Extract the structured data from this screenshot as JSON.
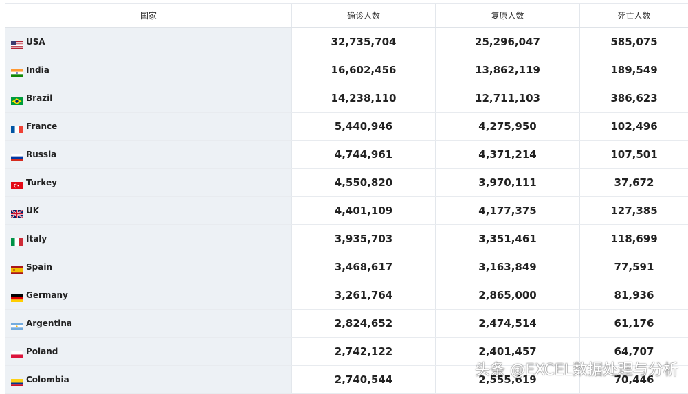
{
  "table": {
    "headers": [
      "国家",
      "确诊人数",
      "复原人数",
      "死亡人数"
    ],
    "rows": [
      {
        "country": "USA",
        "flag": "us-flag-icon",
        "confirmed": "32,735,704",
        "recovered": "25,296,047",
        "deaths": "585,075"
      },
      {
        "country": "India",
        "flag": "india-flag-icon",
        "confirmed": "16,602,456",
        "recovered": "13,862,119",
        "deaths": "189,549"
      },
      {
        "country": "Brazil",
        "flag": "brazil-flag-icon",
        "confirmed": "14,238,110",
        "recovered": "12,711,103",
        "deaths": "386,623"
      },
      {
        "country": "France",
        "flag": "france-flag-icon",
        "confirmed": "5,440,946",
        "recovered": "4,275,950",
        "deaths": "102,496"
      },
      {
        "country": "Russia",
        "flag": "russia-flag-icon",
        "confirmed": "4,744,961",
        "recovered": "4,371,214",
        "deaths": "107,501"
      },
      {
        "country": "Turkey",
        "flag": "turkey-flag-icon",
        "confirmed": "4,550,820",
        "recovered": "3,970,111",
        "deaths": "37,672"
      },
      {
        "country": "UK",
        "flag": "uk-flag-icon",
        "confirmed": "4,401,109",
        "recovered": "4,177,375",
        "deaths": "127,385"
      },
      {
        "country": "Italy",
        "flag": "italy-flag-icon",
        "confirmed": "3,935,703",
        "recovered": "3,351,461",
        "deaths": "118,699"
      },
      {
        "country": "Spain",
        "flag": "spain-flag-icon",
        "confirmed": "3,468,617",
        "recovered": "3,163,849",
        "deaths": "77,591"
      },
      {
        "country": "Germany",
        "flag": "germany-flag-icon",
        "confirmed": "3,261,764",
        "recovered": "2,865,000",
        "deaths": "81,936"
      },
      {
        "country": "Argentina",
        "flag": "argentina-flag-icon",
        "confirmed": "2,824,652",
        "recovered": "2,474,514",
        "deaths": "61,176"
      },
      {
        "country": "Poland",
        "flag": "poland-flag-icon",
        "confirmed": "2,742,122",
        "recovered": "2,401,457",
        "deaths": "64,707"
      },
      {
        "country": "Colombia",
        "flag": "colombia-flag-icon",
        "confirmed": "2,740,544",
        "recovered": "2,555,619",
        "deaths": "70,446"
      }
    ]
  },
  "watermark": "头条 @EXCEL数据处理与分析"
}
